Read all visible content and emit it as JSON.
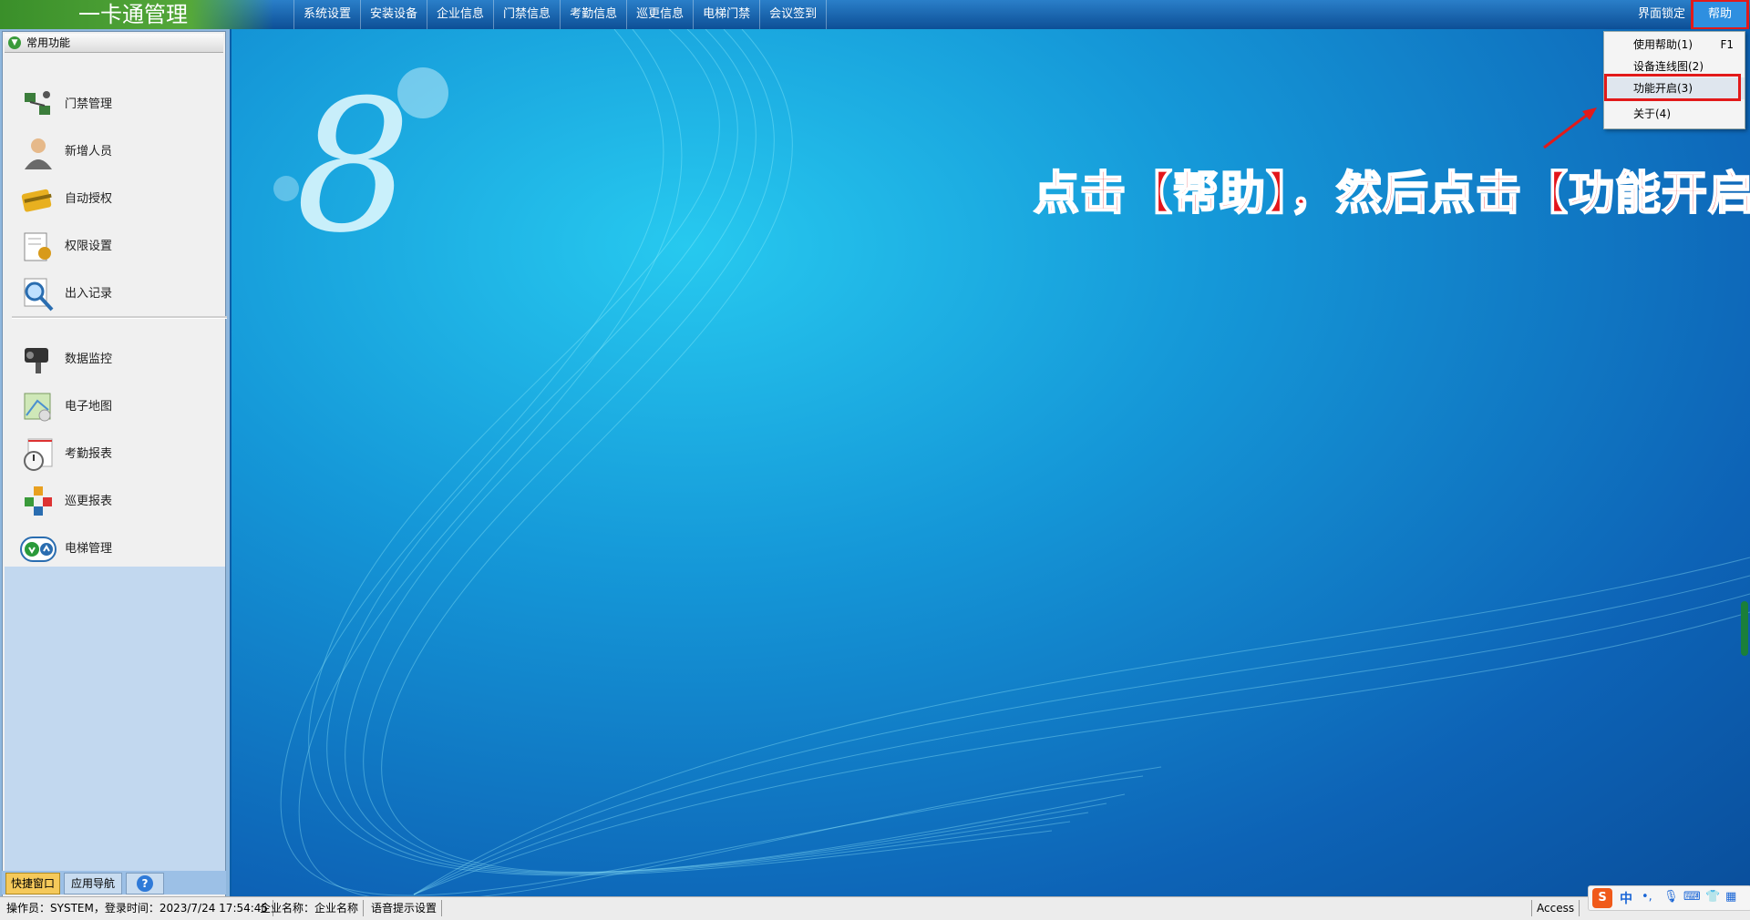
{
  "app": {
    "title": "一卡通管理"
  },
  "menu": [
    "系统设置",
    "安装设备",
    "企业信息",
    "门禁信息",
    "考勤信息",
    "巡更信息",
    "电梯门禁",
    "会议签到"
  ],
  "topright": {
    "lock": "界面锁定",
    "help": "帮助"
  },
  "help_menu": [
    {
      "label": "使用帮助(1)",
      "key": "F1"
    },
    {
      "label": "设备连线图(2)",
      "key": ""
    },
    {
      "label": "功能开启(3)",
      "key": ""
    },
    {
      "label": "关于(4)",
      "key": ""
    }
  ],
  "left_panel": {
    "header": "常用功能",
    "items": [
      {
        "label": "门禁管理",
        "icon": "door-access-icon"
      },
      {
        "label": "新增人员",
        "icon": "person-icon"
      },
      {
        "label": "自动授权",
        "icon": "card-icon"
      },
      {
        "label": "权限设置",
        "icon": "permission-icon"
      },
      {
        "label": "出入记录",
        "icon": "magnifier-icon"
      },
      {
        "label": "数据监控",
        "icon": "camera-icon"
      },
      {
        "label": "电子地图",
        "icon": "map-icon"
      },
      {
        "label": "考勤报表",
        "icon": "clock-icon"
      },
      {
        "label": "巡更报表",
        "icon": "patrol-icon"
      },
      {
        "label": "电梯管理",
        "icon": "elevator-icon"
      }
    ],
    "tabs": {
      "quick": "快捷窗口",
      "nav": "应用导航",
      "help": "?"
    }
  },
  "annotation": "点击【帮助】，然后点击【功能开启】",
  "status": {
    "operator": "操作员：SYSTEM，登录时间：2023/7/24 17:54:45",
    "company": "企业名称：企业名称",
    "voice": "语音提示设置",
    "db": "Access"
  },
  "ime": {
    "logo": "S",
    "lang": "中"
  },
  "colors": {
    "highlight": "#e21a1a",
    "accent": "#0d63b6"
  }
}
